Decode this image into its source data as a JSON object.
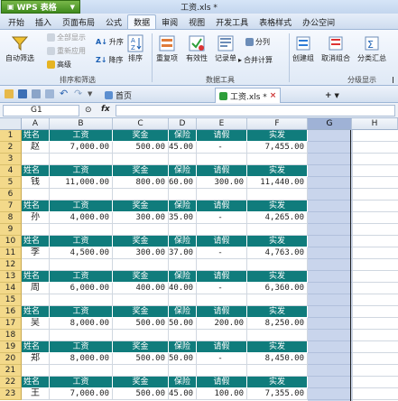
{
  "app": {
    "menu_label": "WPS 表格",
    "doc_title": "工资.xls *"
  },
  "tabs": [
    "开始",
    "插入",
    "页面布局",
    "公式",
    "数据",
    "审阅",
    "视图",
    "开发工具",
    "表格样式",
    "办公空间"
  ],
  "active_tab": 4,
  "ribbon": {
    "auto_filter": "自动筛选",
    "show_all": "全部显示",
    "reapply": "重新应用",
    "advanced": "高级",
    "sort_asc": "升序",
    "sort_desc": "降序",
    "sort": "排序",
    "duplicates": "重复项",
    "validation": "有效性",
    "record_sheet": "记录单",
    "split": "分列",
    "merge_calc": "合并计算",
    "create_group": "创建组",
    "ungroup": "取消组合",
    "subtotal": "分类汇总",
    "group_sort_filter": "排序和筛选",
    "group_data_tools": "数据工具",
    "group_outline": "分级显示"
  },
  "doctabs": {
    "home": "首页",
    "file": "工资.xls *",
    "add": "+"
  },
  "formula_bar": {
    "cell_ref": "G1",
    "fx": "fx",
    "content": ""
  },
  "columns": [
    "A",
    "B",
    "C",
    "D",
    "E",
    "F",
    "G",
    "H"
  ],
  "selected_column": "G",
  "header_labels": [
    "姓名",
    "工资",
    "奖金",
    "保险",
    "请假",
    "实发"
  ],
  "row_numbers": [
    "1",
    "2",
    "3",
    "4",
    "5",
    "6",
    "7",
    "8",
    "9",
    "10",
    "11",
    "12",
    "13",
    "14",
    "15",
    "16",
    "17",
    "18",
    "19",
    "20",
    "21",
    "22",
    "23"
  ],
  "records": [
    {
      "row": "2",
      "name": "赵",
      "salary": "7,000.00",
      "bonus": "500.00",
      "insurance": "45.00",
      "leave": "-",
      "net": "7,455.00"
    },
    {
      "row": "5",
      "name": "钱",
      "salary": "11,000.00",
      "bonus": "800.00",
      "insurance": "60.00",
      "leave": "300.00",
      "net": "11,440.00"
    },
    {
      "row": "8",
      "name": "孙",
      "salary": "4,000.00",
      "bonus": "300.00",
      "insurance": "35.00",
      "leave": "-",
      "net": "4,265.00"
    },
    {
      "row": "11",
      "name": "李",
      "salary": "4,500.00",
      "bonus": "300.00",
      "insurance": "37.00",
      "leave": "-",
      "net": "4,763.00"
    },
    {
      "row": "14",
      "name": "周",
      "salary": "6,000.00",
      "bonus": "400.00",
      "insurance": "40.00",
      "leave": "-",
      "net": "6,360.00"
    },
    {
      "row": "17",
      "name": "吴",
      "salary": "8,000.00",
      "bonus": "500.00",
      "insurance": "50.00",
      "leave": "200.00",
      "net": "8,250.00"
    },
    {
      "row": "20",
      "name": "郑",
      "salary": "8,000.00",
      "bonus": "500.00",
      "insurance": "50.00",
      "leave": "-",
      "net": "8,450.00"
    },
    {
      "row": "23",
      "name": "王",
      "salary": "7,000.00",
      "bonus": "500.00",
      "insurance": "45.00",
      "leave": "100.00",
      "net": "7,355.00"
    }
  ],
  "colors": {
    "header_fill": "#107c7c",
    "row_header_fill": "#f3d98a",
    "selected_column_fill": "#c9d5ec",
    "wps_button": "#3f8a1d"
  }
}
